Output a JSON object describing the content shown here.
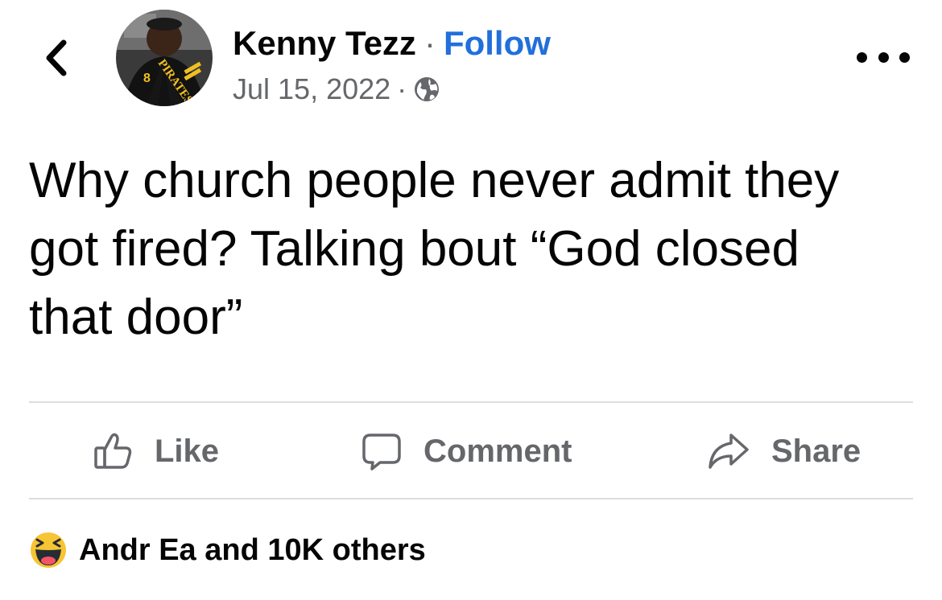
{
  "post": {
    "author": "Kenny Tezz",
    "separator": "·",
    "follow_label": "Follow",
    "date": "Jul 15, 2022",
    "audience_icon": "globe-icon",
    "more_icon": "more-options-icon",
    "avatar_jersey_text": "PIRATES",
    "avatar_jersey_number": "8",
    "text": "Why church people never admit they got fired? Talking bout “God closed that door”"
  },
  "actions": {
    "like": "Like",
    "comment": "Comment",
    "share": "Share"
  },
  "reactions": {
    "icon": "haha-reaction-icon",
    "summary": "Andr Ea and 10K others"
  },
  "colors": {
    "follow_blue": "#216fdb",
    "secondary_text": "#65676b",
    "divider": "#dadde1",
    "haha_yellow": "#f7c433"
  }
}
